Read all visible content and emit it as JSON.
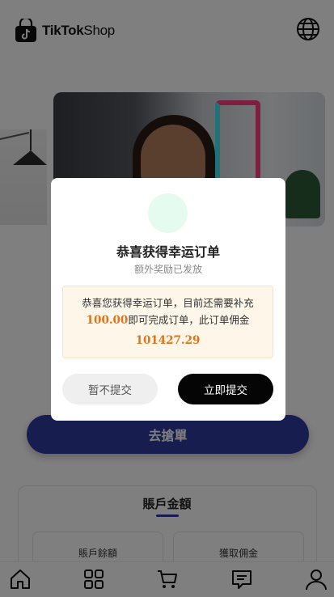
{
  "header": {
    "logo_text_bold": "TikTok",
    "logo_text_light": "Shop",
    "logo_icon": "tiktok-shop-bag-icon",
    "language_icon": "globe-icon"
  },
  "main": {
    "grab_button_label": "去搶單",
    "account": {
      "title": "賬戶金額",
      "stats": [
        {
          "label": "賬戶餘額"
        },
        {
          "label": "獲取佣金"
        }
      ]
    }
  },
  "bottom_nav": {
    "items": [
      {
        "icon": "home-icon"
      },
      {
        "icon": "grid-icon"
      },
      {
        "icon": "cart-icon"
      },
      {
        "icon": "message-icon"
      },
      {
        "icon": "user-icon"
      }
    ]
  },
  "modal": {
    "title": "恭喜获得幸运订单",
    "subtitle": "额外奖励已发放",
    "notice_line1": "恭喜您获得幸运订单，目前还需要补充",
    "amount_required": "100.00",
    "notice_line2": "即可完成订单，此订单佣金",
    "commission_amount": "101427.29",
    "later_button": "暂不提交",
    "submit_button": "立即提交"
  },
  "colors": {
    "accent": "#2f3a9c",
    "amount": "#e0731b",
    "submit_button": "#050505",
    "notice_background": "#fdf6e9",
    "icon_circle": "#e6fbef"
  }
}
